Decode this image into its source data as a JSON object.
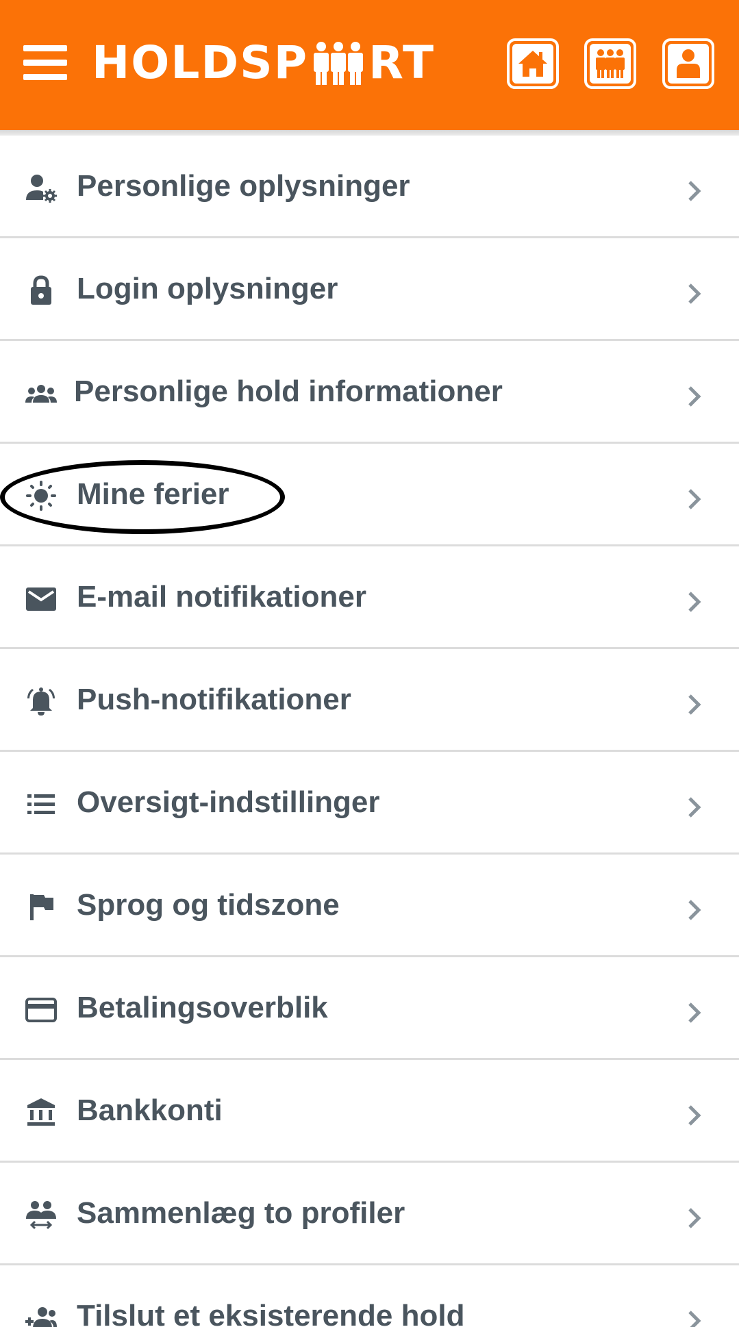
{
  "header": {
    "logo_text_before": "HOLDSP",
    "logo_text_after": "RT",
    "background_color": "#fb7207",
    "icons": [
      "home-icon",
      "team-icon",
      "profile-icon"
    ]
  },
  "settings": {
    "items": [
      {
        "label": "Personlige oplysninger",
        "icon": "user-settings-icon"
      },
      {
        "label": "Login oplysninger",
        "icon": "lock-icon"
      },
      {
        "label": "Personlige hold informationer",
        "icon": "group-icon"
      },
      {
        "label": "Mine ferier",
        "icon": "sun-icon"
      },
      {
        "label": "E-mail notifikationer",
        "icon": "mail-icon"
      },
      {
        "label": "Push-notifikationer",
        "icon": "bell-icon"
      },
      {
        "label": "Oversigt-indstillinger",
        "icon": "list-icon"
      },
      {
        "label": "Sprog og tidszone",
        "icon": "flag-icon"
      },
      {
        "label": "Betalingsoverblik",
        "icon": "credit-card-icon"
      },
      {
        "label": "Bankkonti",
        "icon": "bank-icon"
      },
      {
        "label": "Sammenlæg to profiler",
        "icon": "merge-users-icon"
      },
      {
        "label": "Tilslut et eksisterende hold",
        "icon": "add-group-icon"
      }
    ]
  },
  "annotation": {
    "circled_item": "Mine ferier"
  }
}
